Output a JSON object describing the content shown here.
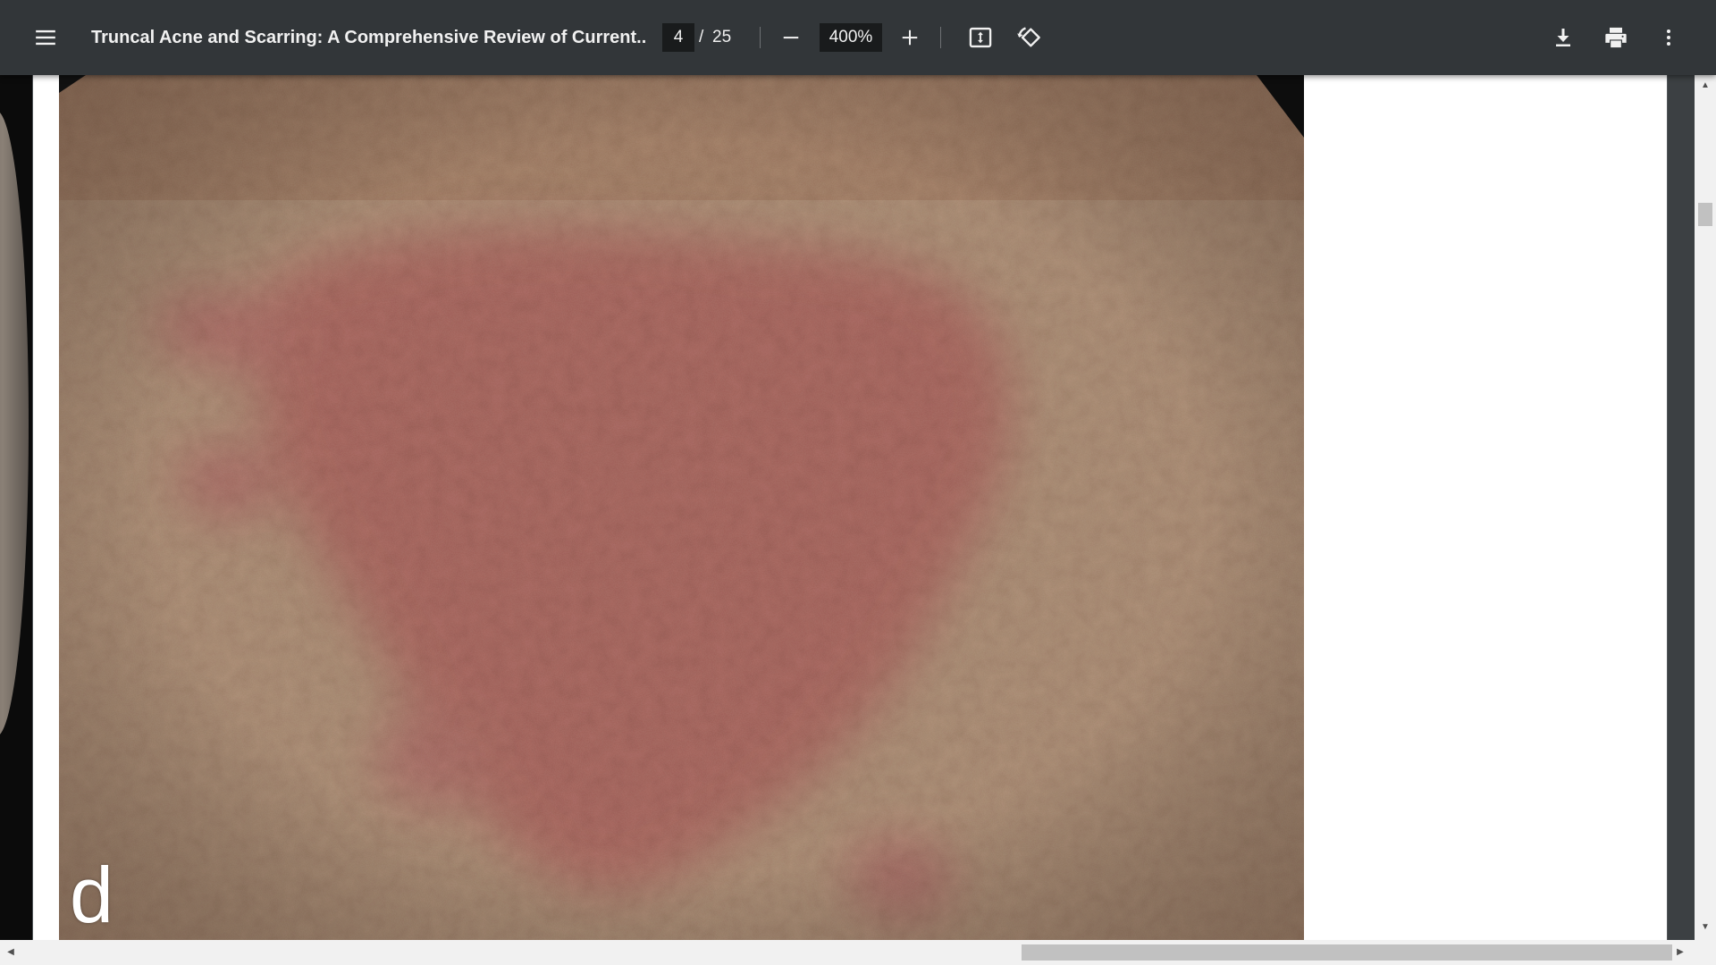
{
  "toolbar": {
    "menu_icon": "hamburger-menu-icon",
    "title": "Truncal Acne and Scarring: A Comprehensive Review of Current...",
    "page": {
      "current": "4",
      "separator": "/",
      "total": "25"
    },
    "zoom": {
      "value": "400%",
      "zoom_out_icon": "minus-icon",
      "zoom_in_icon": "plus-icon"
    },
    "fit_icon": "fit-to-page-icon",
    "rotate_icon": "rotate-counterclockwise-icon",
    "download_icon": "download-icon",
    "print_icon": "print-icon",
    "more_icon": "more-vertical-icon"
  },
  "document": {
    "figure_panel_label": "d"
  },
  "colors": {
    "toolbar_bg": "#323639",
    "viewer_bg": "#525659",
    "input_bg": "#191b1c",
    "text": "#f1f1f1"
  }
}
